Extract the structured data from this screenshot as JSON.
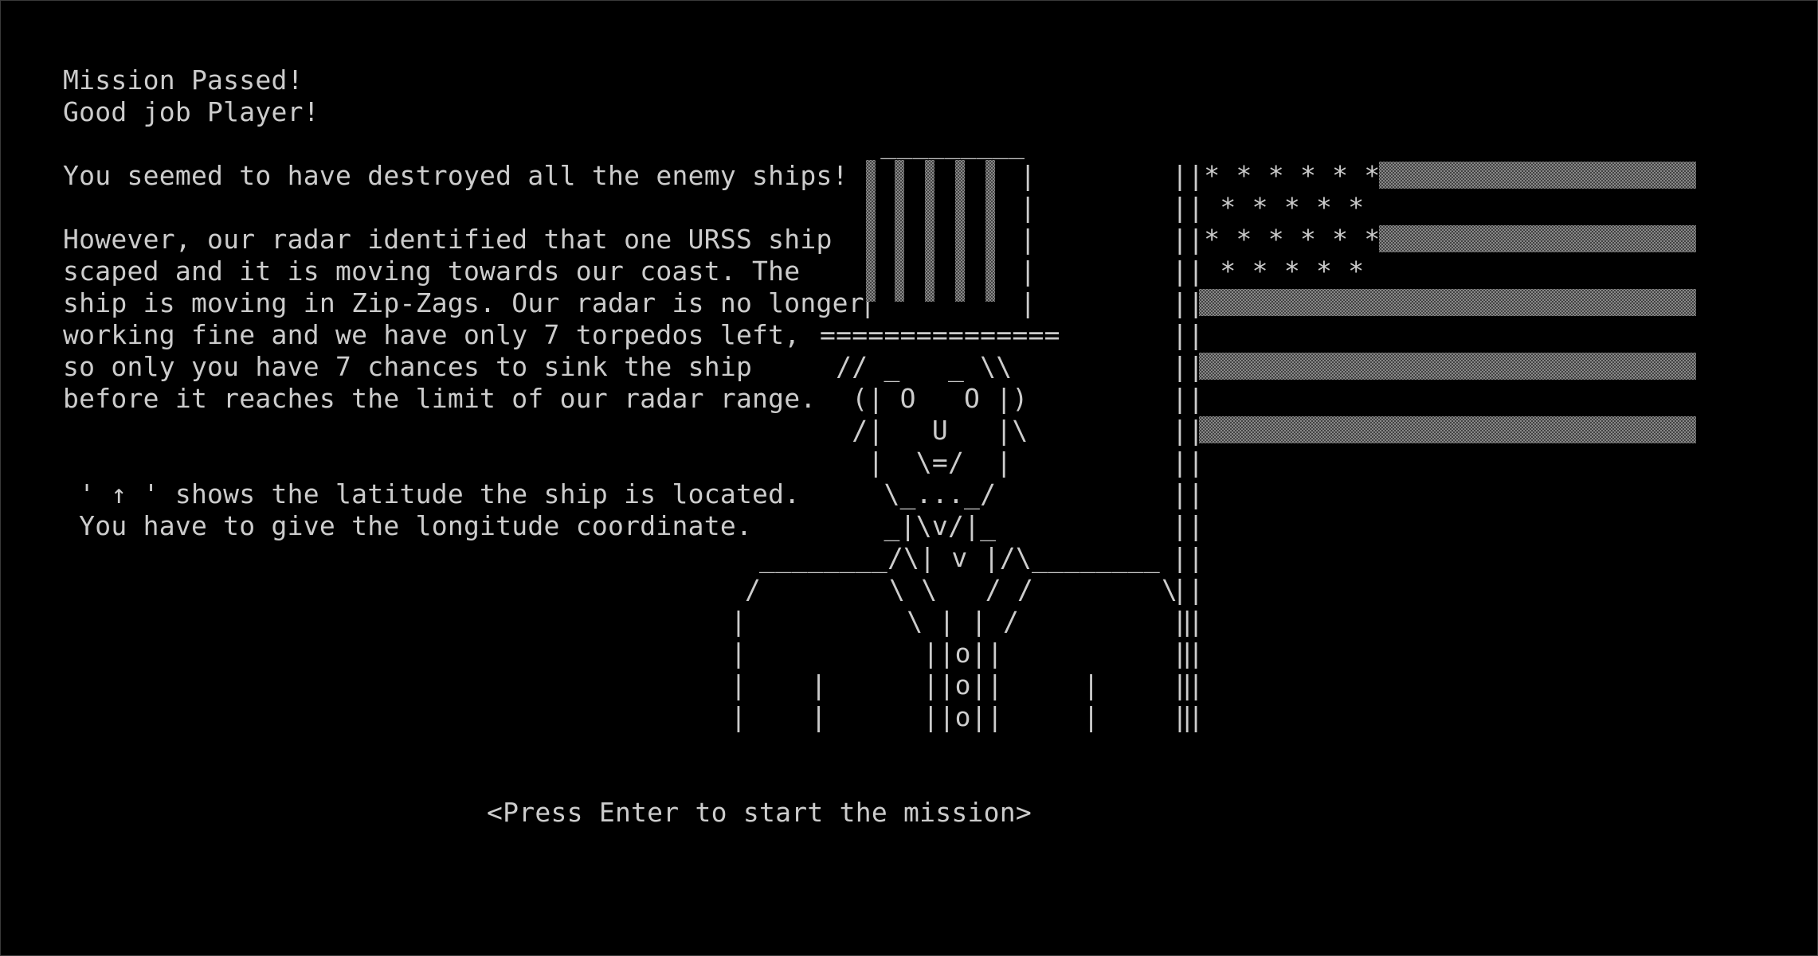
{
  "intro": {
    "title": "Mission Passed!",
    "greeting": "Good job Player!"
  },
  "briefing": {
    "line1": "You seemed to have destroyed all the enemy ships!",
    "paragraph": [
      "However, our radar identified that one URSS ship",
      "scaped and it is moving towards our coast. The",
      "ship is moving in Zip-Zags. Our radar is no longer",
      "working fine and we have only 7 torpedos left,",
      "so only you have 7 chances to sink the ship",
      "before it reaches the limit of our radar range."
    ]
  },
  "instructions": {
    "latitude": " ' ↑ ' shows the latitude the ship is located.",
    "longitude": " You have to give the longitude coordinate."
  },
  "uncle_sam_art": [
    "  _________",
    " |         |",
    " |         |",
    " |         |",
    " |         |",
    " |         |",
    "===============",
    " // _   _ \\\\",
    "  (| O   O |)",
    "  /|   U   |\\",
    "   |  \\=/  |",
    "    \\_..._/",
    "    _|\\v/|_",
    "________/\\| v |/\\________",
    "/        \\ \\   / /        \\",
    "|          \\ | | /          |",
    "|           ||o||           |",
    "|    |      ||o||     |     |",
    "|    |      ||o||     |     |"
  ],
  "flag_art": [
    "||* * * * * *",
    "|| * * * * *",
    "||* * * * * *",
    "|| * * * * *",
    "||",
    "||",
    "||",
    "||",
    "||",
    "||",
    "||",
    "||",
    "||",
    "||",
    "||",
    "||",
    "||",
    "||"
  ],
  "prompt": {
    "start": "<Press Enter to start the mission>"
  }
}
